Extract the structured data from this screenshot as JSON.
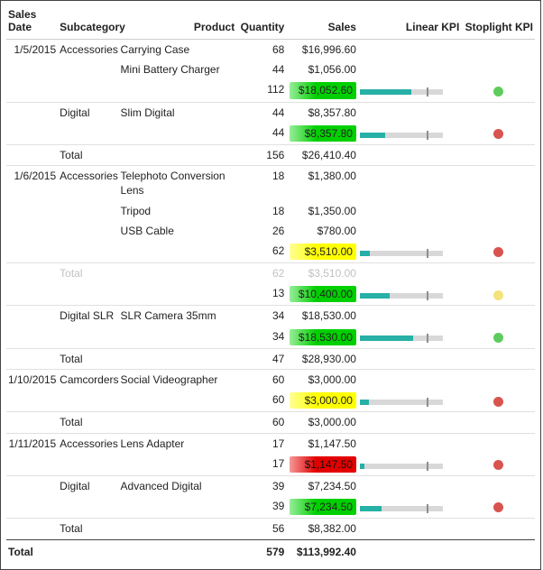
{
  "columns": {
    "date": "Sales Date",
    "subcategory": "Subcategory",
    "product": "Product",
    "quantity": "Quantity",
    "sales": "Sales",
    "linear": "Linear KPI",
    "stoplight": "Stoplight KPI"
  },
  "labels": {
    "total": "Total"
  },
  "totals": {
    "quantity": "579",
    "sales": "$113,992.40"
  },
  "chart_data": {
    "type": "table",
    "title": "Sales matrix with Linear KPI and Stoplight KPI",
    "columns": [
      "Sales Date",
      "Subcategory",
      "Product",
      "Quantity",
      "Sales",
      "Linear KPI fill %",
      "Linear KPI target %",
      "Stoplight KPI"
    ],
    "groups": [
      {
        "date": "1/5/2015",
        "subgroups": [
          {
            "subcategory": "Accessories",
            "rows": [
              {
                "product": "Carrying Case",
                "quantity": 68,
                "sales": 16996.6
              },
              {
                "product": "Mini Battery Charger",
                "quantity": 44,
                "sales": 1056.0
              }
            ],
            "subtotal": {
              "quantity": 112,
              "sales": 18052.6,
              "highlight": "green",
              "linear_fill_pct": 62,
              "linear_target_pct": 80,
              "stoplight": "green"
            }
          },
          {
            "subcategory": "Digital",
            "rows": [
              {
                "product": "Slim Digital",
                "quantity": 44,
                "sales": 8357.8
              }
            ],
            "subtotal": {
              "quantity": 44,
              "sales": 8357.8,
              "highlight": "green",
              "linear_fill_pct": 30,
              "linear_target_pct": 80,
              "stoplight": "red"
            }
          }
        ],
        "date_total": {
          "quantity": 156,
          "sales": 26410.4
        }
      },
      {
        "date": "1/6/2015",
        "subgroups": [
          {
            "subcategory": "Accessories",
            "rows": [
              {
                "product": "Telephoto Conversion Lens",
                "quantity": 18,
                "sales": 1380.0
              },
              {
                "product": "Tripod",
                "quantity": 18,
                "sales": 1350.0
              },
              {
                "product": "USB Cable",
                "quantity": 26,
                "sales": 780.0
              }
            ],
            "subtotal": {
              "quantity": 62,
              "sales": 3510.0,
              "highlight": "yellow",
              "linear_fill_pct": 12,
              "linear_target_pct": 80,
              "stoplight": "red"
            }
          }
        ],
        "date_total": {
          "quantity": 62,
          "sales": 3510.0,
          "muted": true
        },
        "extra_subgroups_after_total": [
          {
            "subcategory": "",
            "rows": [],
            "subtotal": {
              "quantity": 13,
              "sales": 10400.0,
              "highlight": "green",
              "linear_fill_pct": 36,
              "linear_target_pct": 80,
              "stoplight": "yellow"
            }
          },
          {
            "subcategory": "Digital SLR",
            "rows": [
              {
                "product": "SLR Camera 35mm",
                "quantity": 34,
                "sales": 18530.0
              }
            ],
            "subtotal": {
              "quantity": 34,
              "sales": 18530.0,
              "highlight": "green",
              "linear_fill_pct": 64,
              "linear_target_pct": 80,
              "stoplight": "green"
            }
          }
        ],
        "secondary_date_total": {
          "quantity": 47,
          "sales": 28930.0
        }
      },
      {
        "date": "1/10/2015",
        "subgroups": [
          {
            "subcategory": "Camcorders",
            "rows": [
              {
                "product": "Social Videographer",
                "quantity": 60,
                "sales": 3000.0
              }
            ],
            "subtotal": {
              "quantity": 60,
              "sales": 3000.0,
              "highlight": "yellow",
              "linear_fill_pct": 11,
              "linear_target_pct": 80,
              "stoplight": "red"
            }
          }
        ],
        "date_total": {
          "quantity": 60,
          "sales": 3000.0
        }
      },
      {
        "date": "1/11/2015",
        "subgroups": [
          {
            "subcategory": "Accessories",
            "rows": [
              {
                "product": "Lens Adapter",
                "quantity": 17,
                "sales": 1147.5
              }
            ],
            "subtotal": {
              "quantity": 17,
              "sales": 1147.5,
              "highlight": "red",
              "linear_fill_pct": 5,
              "linear_target_pct": 80,
              "stoplight": "red"
            }
          },
          {
            "subcategory": "Digital",
            "rows": [
              {
                "product": "Advanced Digital",
                "quantity": 39,
                "sales": 7234.5
              }
            ],
            "subtotal": {
              "quantity": 39,
              "sales": 7234.5,
              "highlight": "green",
              "linear_fill_pct": 26,
              "linear_target_pct": 80,
              "stoplight": "red"
            }
          }
        ],
        "date_total": {
          "quantity": 56,
          "sales": 8382.0
        }
      }
    ],
    "grand_total": {
      "quantity": 579,
      "sales": 113992.4
    }
  },
  "display": {
    "g0": {
      "date": "1/5/2015",
      "sg0": {
        "subcat": "Accessories",
        "r0": {
          "product": "Carrying Case",
          "qty": "68",
          "sales": "$16,996.60"
        },
        "r1": {
          "product": "Mini Battery Charger",
          "qty": "44",
          "sales": "$1,056.00"
        },
        "sub": {
          "qty": "112",
          "sales": "$18,052.60"
        }
      },
      "sg1": {
        "subcat": "Digital",
        "r0": {
          "product": "Slim Digital",
          "qty": "44",
          "sales": "$8,357.80"
        },
        "sub": {
          "qty": "44",
          "sales": "$8,357.80"
        }
      },
      "total": {
        "qty": "156",
        "sales": "$26,410.40"
      }
    },
    "g1": {
      "date": "1/6/2015",
      "sg0": {
        "subcat": "Accessories",
        "r0": {
          "product": "Telephoto Conversion Lens",
          "qty": "18",
          "sales": "$1,380.00"
        },
        "r1": {
          "product": "Tripod",
          "qty": "18",
          "sales": "$1,350.00"
        },
        "r2": {
          "product": "USB Cable",
          "qty": "26",
          "sales": "$780.00"
        },
        "sub": {
          "qty": "62",
          "sales": "$3,510.00"
        }
      },
      "total": {
        "qty": "62",
        "sales": "$3,510.00"
      },
      "ex0": {
        "sub": {
          "qty": "13",
          "sales": "$10,400.00"
        }
      },
      "ex1": {
        "subcat": "Digital SLR",
        "r0": {
          "product": "SLR Camera 35mm",
          "qty": "34",
          "sales": "$18,530.00"
        },
        "sub": {
          "qty": "34",
          "sales": "$18,530.00"
        }
      },
      "total2": {
        "qty": "47",
        "sales": "$28,930.00"
      }
    },
    "g2": {
      "date": "1/10/2015",
      "sg0": {
        "subcat": "Camcorders",
        "r0": {
          "product": "Social Videographer",
          "qty": "60",
          "sales": "$3,000.00"
        },
        "sub": {
          "qty": "60",
          "sales": "$3,000.00"
        }
      },
      "total": {
        "qty": "60",
        "sales": "$3,000.00"
      }
    },
    "g3": {
      "date": "1/11/2015",
      "sg0": {
        "subcat": "Accessories",
        "r0": {
          "product": "Lens Adapter",
          "qty": "17",
          "sales": "$1,147.50"
        },
        "sub": {
          "qty": "17",
          "sales": "$1,147.50"
        }
      },
      "sg1": {
        "subcat": "Digital",
        "r0": {
          "product": "Advanced Digital",
          "qty": "39",
          "sales": "$7,234.50"
        },
        "sub": {
          "qty": "39",
          "sales": "$7,234.50"
        }
      },
      "total": {
        "qty": "56",
        "sales": "$8,382.00"
      }
    }
  }
}
